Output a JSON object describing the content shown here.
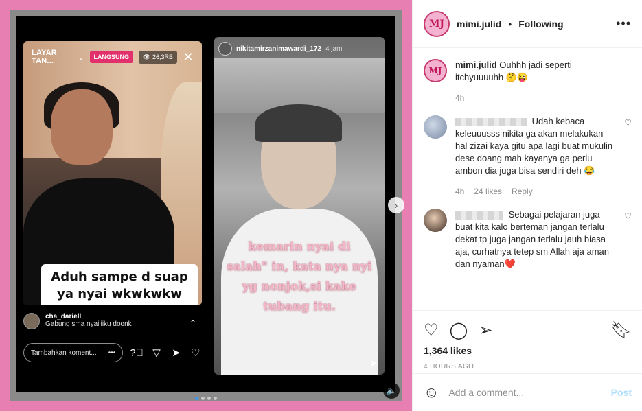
{
  "media": {
    "left": {
      "title": "LAYAR TAN...",
      "live": "LANGSUNG",
      "viewers": "26,3RB",
      "caption": "Aduh sampe d suap ya nyai wkwkwkw parah bgt isa",
      "comment_user": "cha_dariell",
      "comment_text": "Gabung sma nyaiiiiku doonk",
      "input_placeholder": "Tambahkan koment..."
    },
    "right": {
      "user": "nikitamirzanimawardi_172",
      "time": "4 jam",
      "caption": "kemarin nyai di salah\" in, kata nya nyi yg nonjok,si kake tubang itu."
    }
  },
  "post": {
    "author": "mimi.julid",
    "avatar_initials": "MJ",
    "following": "Following",
    "caption": "Ouhhh jadi seperti itchyuuuuhh 🤔😜",
    "caption_time": "4h"
  },
  "comments": [
    {
      "text": "Udah kebaca keleuuusss nikita ga akan melakukan hal zizai kaya gitu apa lagi buat mukulin dese doang mah kayanya ga perlu ambon dia juga bisa sendiri deh 😂",
      "time": "4h",
      "likes": "24 likes",
      "reply": "Reply"
    },
    {
      "text": "Sebagai pelajaran juga buat kita kalo berteman jangan terlalu dekat tp juga jangan terlalu jauh biasa aja, curhatnya tetep sm Allah aja aman dan nyaman❤️"
    }
  ],
  "actions": {
    "likes": "1,364 likes",
    "timestamp": "4 HOURS AGO"
  },
  "add_comment": {
    "placeholder": "Add a comment...",
    "post_label": "Post"
  }
}
